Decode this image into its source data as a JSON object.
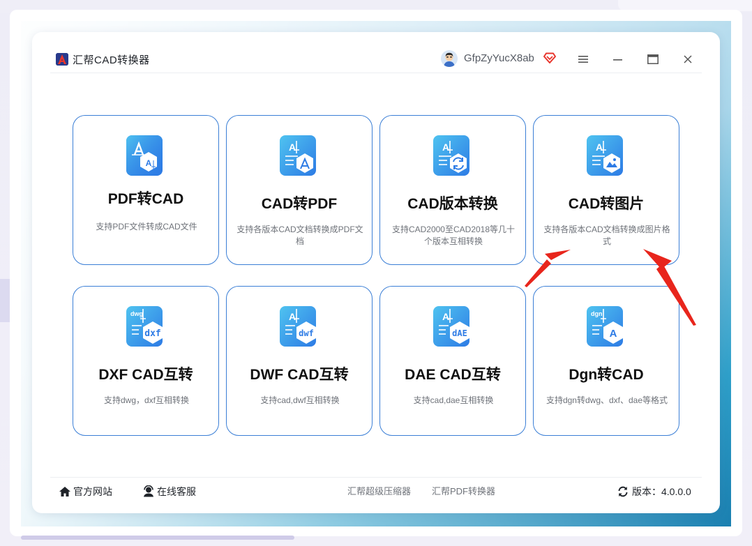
{
  "app": {
    "title": "汇帮CAD转换器",
    "username": "GfpZyYucX8ab"
  },
  "colors": {
    "accent": "#3b7fd6",
    "icon_blue": "#2d7be5",
    "icon_cyan": "#4fc3f0",
    "vip_red": "#e8352c",
    "annotation_red": "#e8251c"
  },
  "icons": {
    "logo": "app-logo-icon",
    "menu": "menu-icon",
    "minimize": "minimize-icon",
    "maximize": "maximize-icon",
    "close": "close-icon",
    "vip": "vip-diamond-icon",
    "home": "home-icon",
    "support": "headset-icon",
    "refresh": "refresh-icon"
  },
  "cards": [
    {
      "title": "PDF转CAD",
      "desc": "支持PDF文件转成CAD文件",
      "badge": ""
    },
    {
      "title": "CAD转PDF",
      "desc": "支持各版本CAD文档转换成PDF文档",
      "badge": ""
    },
    {
      "title": "CAD版本转换",
      "desc": "支持CAD2000至CAD2018等几十个版本互相转换",
      "badge": ""
    },
    {
      "title": "CAD转图片",
      "desc": "支持各版本CAD文档转换成图片格式",
      "badge": ""
    },
    {
      "title": "DXF CAD互转",
      "desc": "支持dwg，dxf互相转换",
      "badge": "dxf",
      "tag": "dwg"
    },
    {
      "title": "DWF CAD互转",
      "desc": "支持cad,dwf互相转换",
      "badge": "dwf",
      "tag": "A"
    },
    {
      "title": "DAE CAD互转",
      "desc": "支持cad,dae互相转换",
      "badge": "dAE",
      "tag": "A"
    },
    {
      "title": "Dgn转CAD",
      "desc": "支持dgn转dwg、dxf、dae等格式",
      "badge": "A",
      "tag": "dgn"
    }
  ],
  "footer": {
    "official_site": "官方网站",
    "online_support": "在线客服",
    "link_compressor": "汇帮超级压缩器",
    "link_pdf": "汇帮PDF转换器",
    "version": "版本：4.0.0.0"
  }
}
